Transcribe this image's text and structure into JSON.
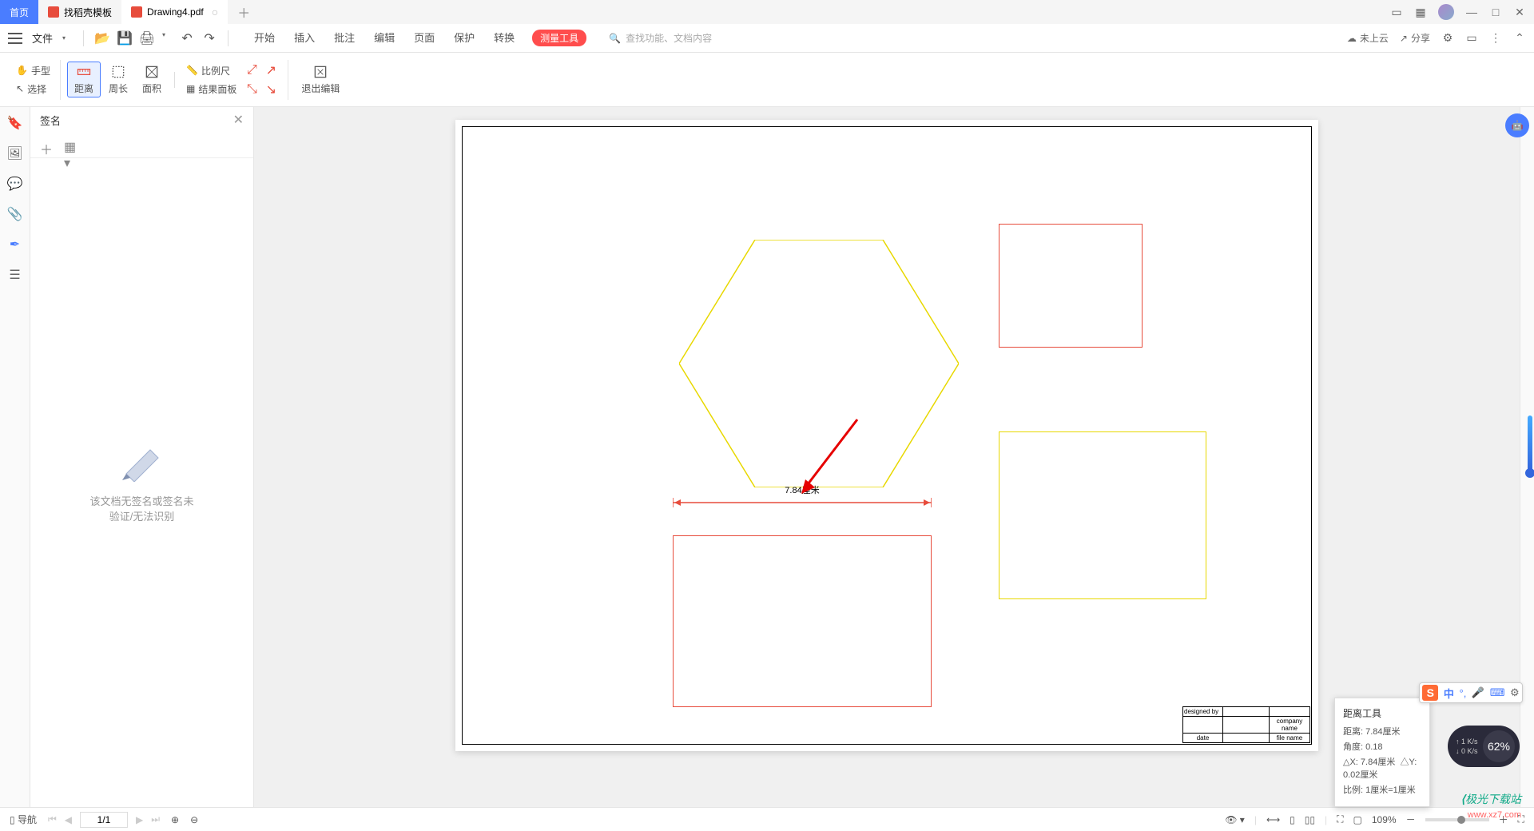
{
  "titlebar": {
    "home": "首页",
    "tab1": "找稻壳模板",
    "tab2": "Drawing4.pdf"
  },
  "menubar": {
    "file": "文件",
    "tabs": [
      "开始",
      "插入",
      "批注",
      "编辑",
      "页面",
      "保护",
      "转换",
      "测量工具"
    ],
    "search": "查找功能、文档内容",
    "cloud": "未上云",
    "share": "分享"
  },
  "toolbar": {
    "hand": "手型",
    "select": "选择",
    "distance": "距离",
    "perimeter": "周长",
    "area": "面积",
    "scale": "比例尺",
    "result_panel": "结果面板",
    "exit": "退出编辑"
  },
  "leftpanel": {
    "title": "签名",
    "empty1": "该文档无签名或签名未",
    "empty2": "验证/无法识别"
  },
  "canvas": {
    "measure_label": "7.84厘米",
    "titleblock": {
      "designed": "designed by",
      "date": "date",
      "company": "company name",
      "filename": "file name"
    }
  },
  "float": {
    "title": "距离工具",
    "dist_label": "距离:",
    "dist_val": "7.84厘米",
    "angle_label": "角度:",
    "angle_val": "0.18",
    "dx_label": "△X:",
    "dx_val": "7.84厘米",
    "dy_label": "△Y:",
    "dy_val": "0.02厘米",
    "ratio_label": "比例:",
    "ratio_val": "1厘米=1厘米"
  },
  "status": {
    "nav": "导航",
    "page": "1/1",
    "zoom": "109%"
  },
  "ime": {
    "lang": "中"
  },
  "speed": {
    "up": "1 K/s",
    "down": "0 K/s",
    "pct": "62%"
  },
  "watermark": {
    "line1": "极光下载站",
    "line2": "www.xz7.com"
  }
}
